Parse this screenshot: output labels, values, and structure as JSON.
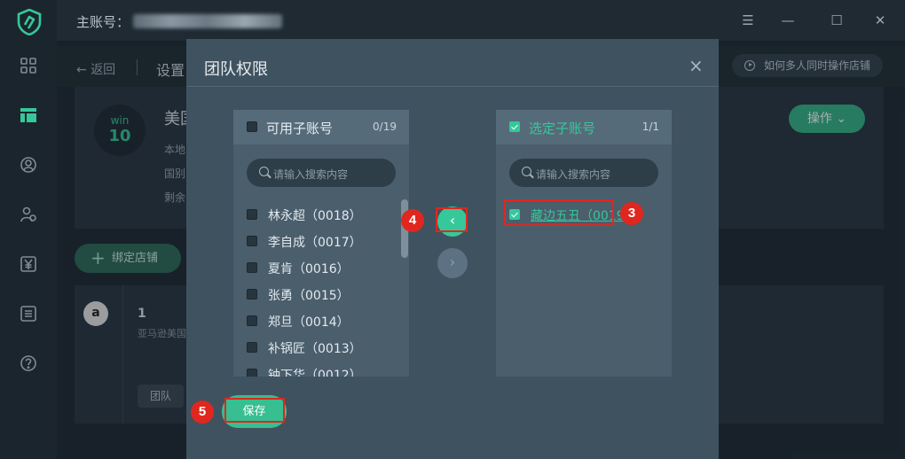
{
  "titlebar": {
    "account_label": "主账号：",
    "controls": [
      "☰",
      "—",
      "☐",
      "✕"
    ]
  },
  "rail": {
    "icons": [
      "dashboard-icon",
      "shop-icon",
      "user-icon",
      "team-icon",
      "finance-icon",
      "list-icon",
      "help-icon"
    ],
    "active": "shop-icon",
    "accent": "#36c89a"
  },
  "background": {
    "back_label": "返回",
    "crumb": "设置",
    "help_label": "如何多人同时操作店铺",
    "win_label": "win",
    "win_number": "10",
    "shop_name": "美国",
    "meta": [
      "本地",
      "国别",
      "剩余"
    ],
    "op_label": "操作",
    "bind_label": "绑定店铺",
    "row_number": "1",
    "row_market": "亚马逊美国",
    "team_label": "团队",
    "amazon_letter": "a"
  },
  "dialog": {
    "title": "团队权限",
    "close": "×",
    "left_panel": {
      "title": "可用子账号",
      "count": "0/19",
      "search_placeholder": "请输入搜索内容",
      "items": [
        {
          "label": "林永超（0018）"
        },
        {
          "label": "李自成（0017）"
        },
        {
          "label": "夏肯（0016）"
        },
        {
          "label": "张勇（0015）"
        },
        {
          "label": "郑旦（0014）"
        },
        {
          "label": "补锅匠（0013）"
        },
        {
          "label": "钟下华（0012）"
        }
      ]
    },
    "right_panel": {
      "title": "选定子账号",
      "count": "1/1",
      "search_placeholder": "请输入搜索内容",
      "items": [
        {
          "label": "藏边五丑（0019"
        }
      ]
    },
    "move_left": "‹",
    "move_right": "›",
    "save_label": "保存"
  },
  "annotations": [
    "3",
    "4",
    "5"
  ],
  "colors": {
    "accent": "#36c89a",
    "annotation": "#e0271f",
    "dialog_bg": "#3f5260"
  }
}
